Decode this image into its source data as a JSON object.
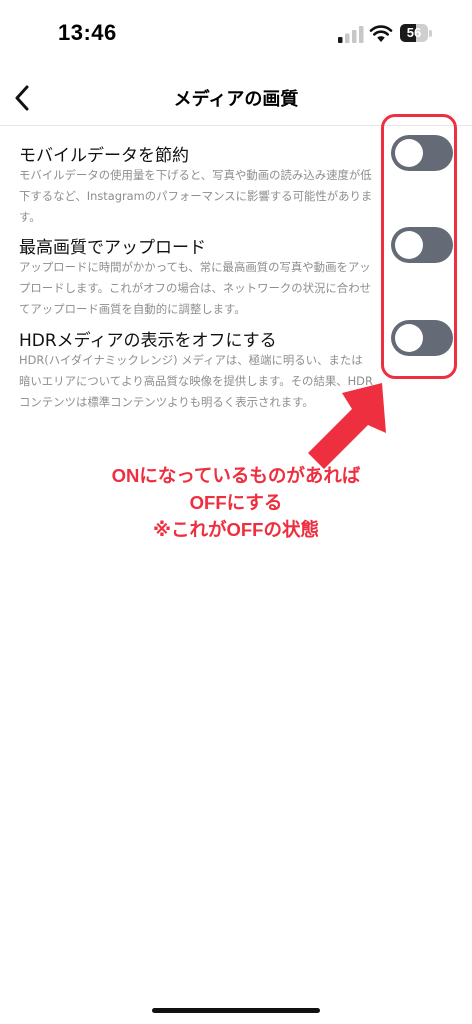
{
  "status_bar": {
    "time": "13:46",
    "battery_level": "56",
    "battery_fraction": 0.56,
    "icons": [
      "signal-icon",
      "wifi-icon",
      "battery-icon"
    ]
  },
  "header": {
    "title": "メディアの画質",
    "back_icon": "chevron-left-icon"
  },
  "settings": [
    {
      "title": "モバイルデータを節約",
      "description": "モバイルデータの使用量を下げると、写真や動画の読み込み速度が低下するなど、Instagramのパフォーマンスに影響する可能性があります。",
      "enabled": false
    },
    {
      "title": "最高画質でアップロード",
      "description": "アップロードに時間がかかっても、常に最高画質の写真や動画をアップロードします。これがオフの場合は、ネットワークの状況に合わせてアップロード画質を自動的に調整します。",
      "enabled": false
    },
    {
      "title": "HDRメディアの表示をオフにする",
      "description": "HDR(ハイダイナミックレンジ) メディアは、極端に明るい、または暗いエリアについてより高品質な映像を提供します。その結果、HDR コンテンツは標準コンテンツよりも明るく表示されます。",
      "enabled": false
    }
  ],
  "annotation": {
    "line1": "ONになっているものがあれば",
    "line2": "OFFにする",
    "line3": "※これがOFFの状態",
    "color": "#ee2f3f"
  },
  "colors": {
    "toggle_off": "#646b76",
    "annotation_red": "#ee2f3f",
    "description_gray": "#8e8e8e"
  }
}
